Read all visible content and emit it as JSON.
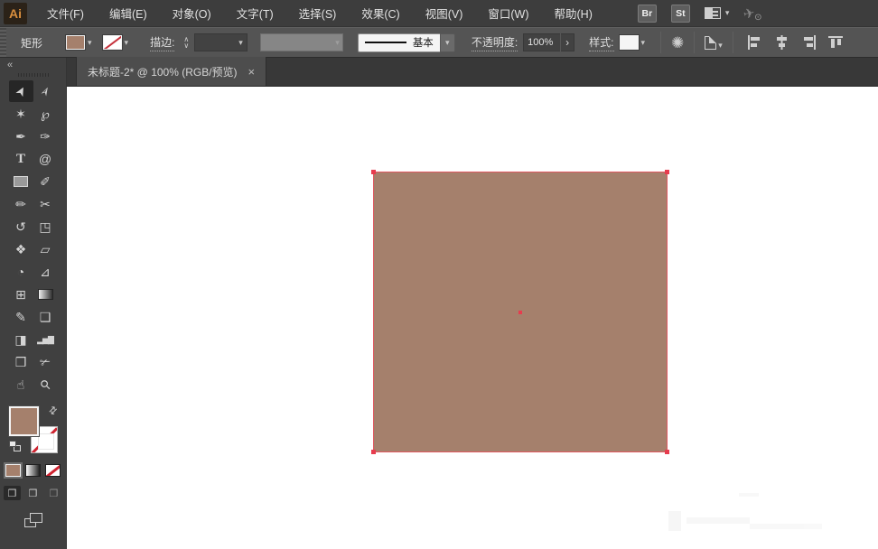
{
  "menubar": {
    "logo": "Ai",
    "items": [
      {
        "id": "file",
        "label": "文件(F)"
      },
      {
        "id": "edit",
        "label": "编辑(E)"
      },
      {
        "id": "object",
        "label": "对象(O)"
      },
      {
        "id": "type",
        "label": "文字(T)"
      },
      {
        "id": "select",
        "label": "选择(S)"
      },
      {
        "id": "effect",
        "label": "效果(C)"
      },
      {
        "id": "view",
        "label": "视图(V)"
      },
      {
        "id": "window",
        "label": "窗口(W)"
      },
      {
        "id": "help",
        "label": "帮助(H)"
      }
    ],
    "br_label": "Br",
    "st_label": "St"
  },
  "controlbar": {
    "selection_type": "矩形",
    "stroke_label": "描边:",
    "stroke_weight_value": "",
    "brush_name": "基本",
    "opacity_label": "不透明度:",
    "opacity_value": "100%",
    "style_label": "样式:"
  },
  "tabbar": {
    "title": "未标题-2* @ 100% (RGB/预览)",
    "close": "×"
  },
  "icons": {
    "chevron_down": "▾",
    "stepper_up": "∧",
    "stepper_down": "∨",
    "collapse": "«",
    "recolor_wheel": "✺",
    "more_arrow": "›",
    "swap_arrows": "⇄",
    "sync_plane": "✈",
    "draw_mode": "❐"
  },
  "toolbar": {
    "tools": [
      {
        "name": "selection-tool",
        "glyph": "➤",
        "cls": "rot60",
        "active": true
      },
      {
        "name": "direct-selection-tool",
        "glyph": "➢",
        "cls": "rot60"
      },
      {
        "name": "magic-wand-tool",
        "glyph": "✶"
      },
      {
        "name": "lasso-tool",
        "glyph": "℘"
      },
      {
        "name": "pen-tool",
        "glyph": "✒"
      },
      {
        "name": "curvature-tool",
        "glyph": "✑"
      },
      {
        "name": "type-tool",
        "glyph": "T",
        "cls": "serifT"
      },
      {
        "name": "spiral-line-tool",
        "glyph": "@"
      },
      {
        "name": "rectangle-tool",
        "kind": "swatch"
      },
      {
        "name": "paintbrush-tool",
        "glyph": "✐"
      },
      {
        "name": "pencil-tool",
        "glyph": "✏"
      },
      {
        "name": "scissors-tool",
        "glyph": "✂"
      },
      {
        "name": "rotate-tool",
        "glyph": "↺"
      },
      {
        "name": "scale-tool",
        "glyph": "◳"
      },
      {
        "name": "width-tool",
        "glyph": "❖"
      },
      {
        "name": "free-transform-tool",
        "glyph": "▱"
      },
      {
        "name": "shape-builder-tool",
        "glyph": "◔"
      },
      {
        "name": "perspective-grid-tool",
        "glyph": "⊿"
      },
      {
        "name": "mesh-tool",
        "glyph": "⊞"
      },
      {
        "name": "gradient-tool",
        "kind": "gradient"
      },
      {
        "name": "eyedropper-tool",
        "glyph": "✎"
      },
      {
        "name": "blend-tool",
        "glyph": "❑"
      },
      {
        "name": "symbol-sprayer-tool",
        "glyph": "◨"
      },
      {
        "name": "column-graph-tool",
        "glyph": "▂▅▇",
        "cls": "bars"
      },
      {
        "name": "artboard-tool",
        "glyph": "❒"
      },
      {
        "name": "slice-tool",
        "glyph": "✃"
      },
      {
        "name": "hand-tool",
        "glyph": "☝"
      },
      {
        "name": "zoom-tool",
        "glyph": "⚲",
        "cls": "rot45"
      }
    ]
  },
  "colors": {
    "fill": "#a5806c",
    "selection_stroke": "#e05a61",
    "anchor": "#e73c4e",
    "none_slash": "#c6323c"
  },
  "canvas_object": {
    "type": "rectangle",
    "fill": "#a5806c",
    "selection_stroke": "#e05a61",
    "anchor": "#e73c4e"
  }
}
